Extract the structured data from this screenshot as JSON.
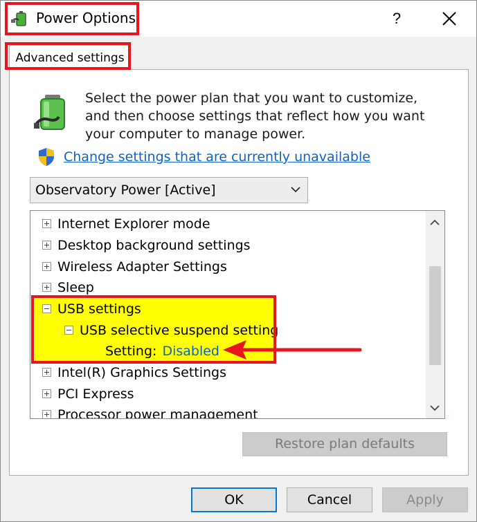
{
  "window": {
    "title": "Power Options",
    "help_label": "?"
  },
  "tab": {
    "label": "Advanced settings"
  },
  "description": "Select the power plan that you want to customize, and then choose settings that reflect how you want your computer to manage power.",
  "change_link": "Change settings that are currently unavailable",
  "plan_select": {
    "value": "Observatory Power [Active]"
  },
  "tree": {
    "items": [
      {
        "label": "Internet Explorer mode",
        "expanded": false
      },
      {
        "label": "Desktop background settings",
        "expanded": false
      },
      {
        "label": "Wireless Adapter Settings",
        "expanded": false
      },
      {
        "label": "Sleep",
        "expanded": false
      },
      {
        "label": "USB settings",
        "expanded": true
      },
      {
        "label": "USB selective suspend setting",
        "expanded": true
      },
      {
        "label": "Intel(R) Graphics Settings",
        "expanded": false
      },
      {
        "label": "PCI Express",
        "expanded": false
      },
      {
        "label": "Processor power management",
        "expanded": false
      }
    ],
    "setting_label": "Setting:",
    "setting_value": "Disabled"
  },
  "buttons": {
    "restore": "Restore plan defaults",
    "ok": "OK",
    "cancel": "Cancel",
    "apply": "Apply"
  },
  "colors": {
    "annotation_red": "#e8141e",
    "highlight_yellow": "#ffff00",
    "link_blue": "#0b63c9"
  }
}
